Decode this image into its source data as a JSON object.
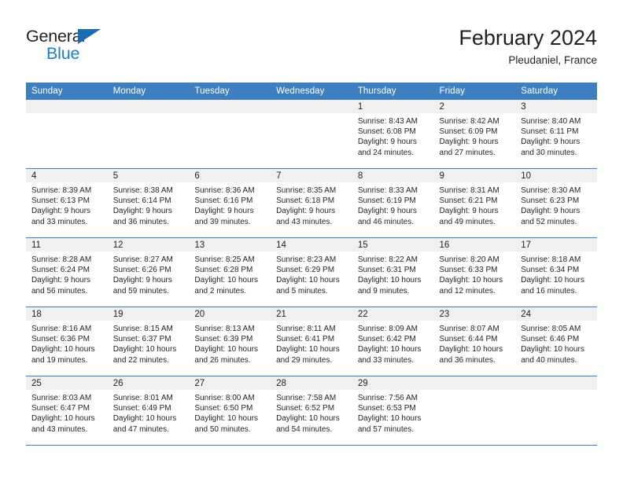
{
  "brand": {
    "name_part1": "General",
    "name_part2": "Blue",
    "triangle_color": "#1c6cb4",
    "blue_color": "#1c7fd4"
  },
  "header": {
    "title": "February 2024",
    "location": "Pleudaniel, France"
  },
  "theme": {
    "header_bg": "#3d7fc1",
    "header_text": "#ffffff",
    "daynum_band_bg": "#f0f0f0",
    "row_border": "#3d7fc1",
    "body_text": "#231f20"
  },
  "weekdays": [
    "Sunday",
    "Monday",
    "Tuesday",
    "Wednesday",
    "Thursday",
    "Friday",
    "Saturday"
  ],
  "labels": {
    "sunrise_prefix": "Sunrise:",
    "sunset_prefix": "Sunset:",
    "daylight_prefix": "Daylight:"
  },
  "weeks": [
    [
      {
        "empty": true
      },
      {
        "empty": true
      },
      {
        "empty": true
      },
      {
        "empty": true
      },
      {
        "day": "1",
        "sunrise": "Sunrise: 8:43 AM",
        "sunset": "Sunset: 6:08 PM",
        "daylight": "Daylight: 9 hours and 24 minutes."
      },
      {
        "day": "2",
        "sunrise": "Sunrise: 8:42 AM",
        "sunset": "Sunset: 6:09 PM",
        "daylight": "Daylight: 9 hours and 27 minutes."
      },
      {
        "day": "3",
        "sunrise": "Sunrise: 8:40 AM",
        "sunset": "Sunset: 6:11 PM",
        "daylight": "Daylight: 9 hours and 30 minutes."
      }
    ],
    [
      {
        "day": "4",
        "sunrise": "Sunrise: 8:39 AM",
        "sunset": "Sunset: 6:13 PM",
        "daylight": "Daylight: 9 hours and 33 minutes."
      },
      {
        "day": "5",
        "sunrise": "Sunrise: 8:38 AM",
        "sunset": "Sunset: 6:14 PM",
        "daylight": "Daylight: 9 hours and 36 minutes."
      },
      {
        "day": "6",
        "sunrise": "Sunrise: 8:36 AM",
        "sunset": "Sunset: 6:16 PM",
        "daylight": "Daylight: 9 hours and 39 minutes."
      },
      {
        "day": "7",
        "sunrise": "Sunrise: 8:35 AM",
        "sunset": "Sunset: 6:18 PM",
        "daylight": "Daylight: 9 hours and 43 minutes."
      },
      {
        "day": "8",
        "sunrise": "Sunrise: 8:33 AM",
        "sunset": "Sunset: 6:19 PM",
        "daylight": "Daylight: 9 hours and 46 minutes."
      },
      {
        "day": "9",
        "sunrise": "Sunrise: 8:31 AM",
        "sunset": "Sunset: 6:21 PM",
        "daylight": "Daylight: 9 hours and 49 minutes."
      },
      {
        "day": "10",
        "sunrise": "Sunrise: 8:30 AM",
        "sunset": "Sunset: 6:23 PM",
        "daylight": "Daylight: 9 hours and 52 minutes."
      }
    ],
    [
      {
        "day": "11",
        "sunrise": "Sunrise: 8:28 AM",
        "sunset": "Sunset: 6:24 PM",
        "daylight": "Daylight: 9 hours and 56 minutes."
      },
      {
        "day": "12",
        "sunrise": "Sunrise: 8:27 AM",
        "sunset": "Sunset: 6:26 PM",
        "daylight": "Daylight: 9 hours and 59 minutes."
      },
      {
        "day": "13",
        "sunrise": "Sunrise: 8:25 AM",
        "sunset": "Sunset: 6:28 PM",
        "daylight": "Daylight: 10 hours and 2 minutes."
      },
      {
        "day": "14",
        "sunrise": "Sunrise: 8:23 AM",
        "sunset": "Sunset: 6:29 PM",
        "daylight": "Daylight: 10 hours and 5 minutes."
      },
      {
        "day": "15",
        "sunrise": "Sunrise: 8:22 AM",
        "sunset": "Sunset: 6:31 PM",
        "daylight": "Daylight: 10 hours and 9 minutes."
      },
      {
        "day": "16",
        "sunrise": "Sunrise: 8:20 AM",
        "sunset": "Sunset: 6:33 PM",
        "daylight": "Daylight: 10 hours and 12 minutes."
      },
      {
        "day": "17",
        "sunrise": "Sunrise: 8:18 AM",
        "sunset": "Sunset: 6:34 PM",
        "daylight": "Daylight: 10 hours and 16 minutes."
      }
    ],
    [
      {
        "day": "18",
        "sunrise": "Sunrise: 8:16 AM",
        "sunset": "Sunset: 6:36 PM",
        "daylight": "Daylight: 10 hours and 19 minutes."
      },
      {
        "day": "19",
        "sunrise": "Sunrise: 8:15 AM",
        "sunset": "Sunset: 6:37 PM",
        "daylight": "Daylight: 10 hours and 22 minutes."
      },
      {
        "day": "20",
        "sunrise": "Sunrise: 8:13 AM",
        "sunset": "Sunset: 6:39 PM",
        "daylight": "Daylight: 10 hours and 26 minutes."
      },
      {
        "day": "21",
        "sunrise": "Sunrise: 8:11 AM",
        "sunset": "Sunset: 6:41 PM",
        "daylight": "Daylight: 10 hours and 29 minutes."
      },
      {
        "day": "22",
        "sunrise": "Sunrise: 8:09 AM",
        "sunset": "Sunset: 6:42 PM",
        "daylight": "Daylight: 10 hours and 33 minutes."
      },
      {
        "day": "23",
        "sunrise": "Sunrise: 8:07 AM",
        "sunset": "Sunset: 6:44 PM",
        "daylight": "Daylight: 10 hours and 36 minutes."
      },
      {
        "day": "24",
        "sunrise": "Sunrise: 8:05 AM",
        "sunset": "Sunset: 6:46 PM",
        "daylight": "Daylight: 10 hours and 40 minutes."
      }
    ],
    [
      {
        "day": "25",
        "sunrise": "Sunrise: 8:03 AM",
        "sunset": "Sunset: 6:47 PM",
        "daylight": "Daylight: 10 hours and 43 minutes."
      },
      {
        "day": "26",
        "sunrise": "Sunrise: 8:01 AM",
        "sunset": "Sunset: 6:49 PM",
        "daylight": "Daylight: 10 hours and 47 minutes."
      },
      {
        "day": "27",
        "sunrise": "Sunrise: 8:00 AM",
        "sunset": "Sunset: 6:50 PM",
        "daylight": "Daylight: 10 hours and 50 minutes."
      },
      {
        "day": "28",
        "sunrise": "Sunrise: 7:58 AM",
        "sunset": "Sunset: 6:52 PM",
        "daylight": "Daylight: 10 hours and 54 minutes."
      },
      {
        "day": "29",
        "sunrise": "Sunrise: 7:56 AM",
        "sunset": "Sunset: 6:53 PM",
        "daylight": "Daylight: 10 hours and 57 minutes."
      },
      {
        "empty": true
      },
      {
        "empty": true
      }
    ]
  ]
}
